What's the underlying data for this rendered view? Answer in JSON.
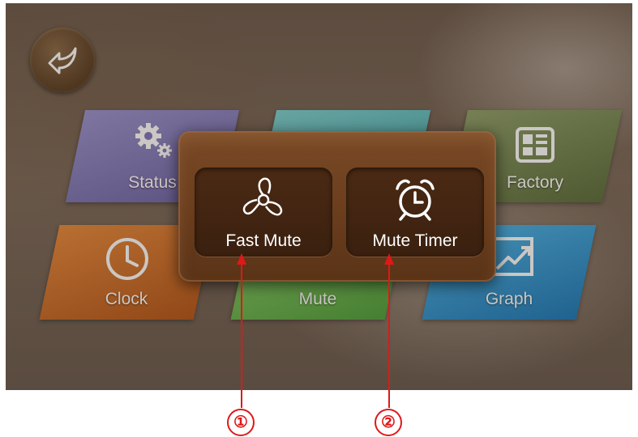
{
  "screen": {
    "back_button": {
      "icon": "back-arrow-icon"
    },
    "tiles": {
      "status": {
        "label": "Status",
        "icon": "gears-icon",
        "color": "#7f77bb"
      },
      "blue": {
        "label": "",
        "color": "#5bbdbf"
      },
      "factory": {
        "label": "Factory",
        "icon": "layout-grid-icon",
        "color": "#748552"
      },
      "clock": {
        "label": "Clock",
        "icon": "clock-icon",
        "color": "#d06e28"
      },
      "mute": {
        "label": "Mute",
        "color": "#6fbc55"
      },
      "graph": {
        "label": "Graph",
        "icon": "trend-chart-icon",
        "color": "#2f95d2"
      }
    }
  },
  "popup": {
    "buttons": [
      {
        "label": "Fast Mute",
        "icon": "fan-icon"
      },
      {
        "label": "Mute Timer",
        "icon": "alarm-clock-icon"
      }
    ]
  },
  "annotations": {
    "markers": [
      "①",
      "②"
    ],
    "color": "#e01818"
  }
}
